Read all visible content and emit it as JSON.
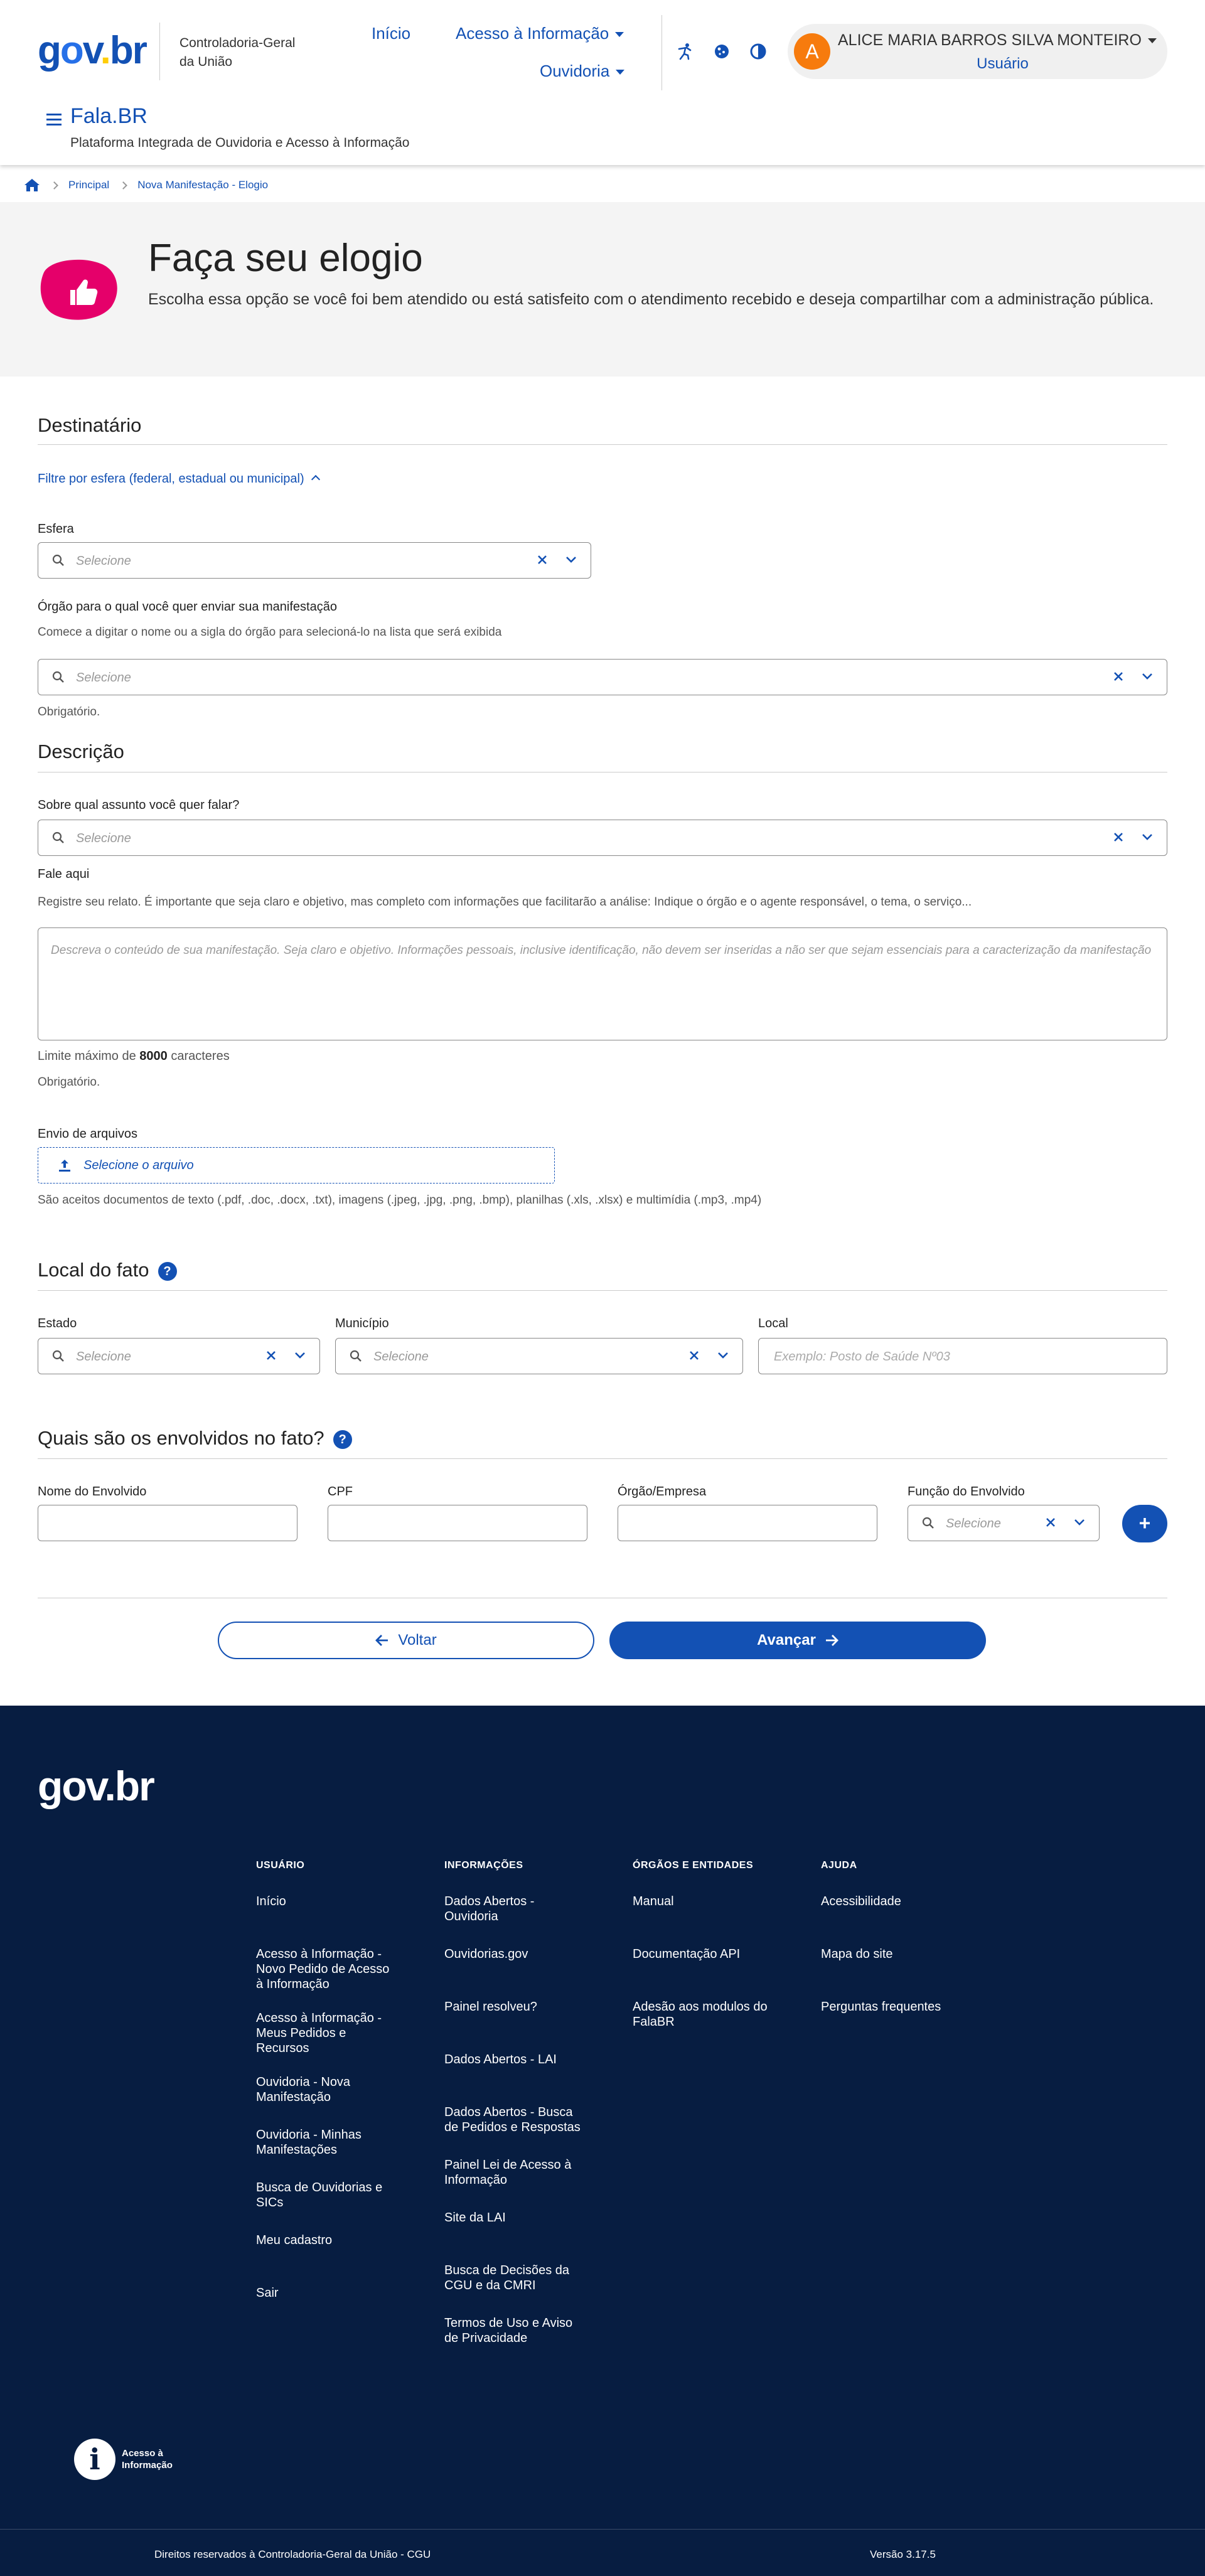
{
  "header": {
    "logo": {
      "g": "g",
      "o": "o",
      "v": "v",
      "dot": ".",
      "b": "b",
      "r": "r"
    },
    "org_line1": "Controladoria-Geral",
    "org_line2": "da União",
    "nav_inicio": "Início",
    "nav_acesso": "Acesso à Informação",
    "nav_ouvidoria": "Ouvidoria",
    "user_initial": "A",
    "user_name": "ALICE MARIA BARROS SILVA MONTEIRO",
    "user_role": "Usuário",
    "app_title": "Fala.BR",
    "app_subtitle": "Plataforma Integrada de Ouvidoria e Acesso à Informação"
  },
  "breadcrumb": {
    "item1": "Principal",
    "item2": "Nova Manifestação - Elogio"
  },
  "hero": {
    "title": "Faça seu elogio",
    "description": "Escolha essa opção se você foi bem atendido ou está satisfeito com o atendimento recebido e deseja compartilhar com a administração pública."
  },
  "destinatario": {
    "section_title": "Destinatário",
    "filter_link": "Filtre por esfera (federal, estadual ou municipal)",
    "esfera_label": "Esfera",
    "esfera_placeholder": "Selecione",
    "orgao_label": "Órgão para o qual você quer enviar sua manifestação",
    "orgao_hint": "Comece a digitar o nome ou a sigla do órgão para selecioná-lo na lista que será exibida",
    "orgao_placeholder": "Selecione",
    "required": "Obrigatório."
  },
  "descricao": {
    "section_title": "Descrição",
    "assunto_label": "Sobre qual assunto você quer falar?",
    "assunto_placeholder": "Selecione",
    "fale_label": "Fale aqui",
    "fale_hint": "Registre seu relato. É importante que seja claro e objetivo, mas completo com informações que facilitarão a análise: Indique o órgão e o agente responsável, o tema, o serviço...",
    "textarea_placeholder": "Descreva o conteúdo de sua manifestação. Seja claro e objetivo. Informações pessoais, inclusive identificação, não devem ser inseridas a não ser que sejam essenciais para a caracterização da manifestação",
    "limit_prefix": "Limite máximo de ",
    "limit_value": "8000",
    "limit_suffix": " caracteres",
    "required": "Obrigatório.",
    "upload_label": "Envio de arquivos",
    "upload_button": "Selecione o arquivo",
    "upload_hint": "São aceitos documentos de texto (.pdf, .doc, .docx, .txt), imagens (.jpeg, .jpg, .png, .bmp), planilhas (.xls, .xlsx) e multimídia (.mp3, .mp4)"
  },
  "local": {
    "section_title": "Local do fato",
    "help": "?",
    "estado_label": "Estado",
    "estado_placeholder": "Selecione",
    "municipio_label": "Município",
    "municipio_placeholder": "Selecione",
    "local_label": "Local",
    "local_placeholder": "Exemplo: Posto de Saúde Nº03"
  },
  "envolvidos": {
    "section_title": "Quais são os envolvidos no fato?",
    "help": "?",
    "nome_label": "Nome do Envolvido",
    "cpf_label": "CPF",
    "orgao_label": "Órgão/Empresa",
    "funcao_label": "Função do Envolvido",
    "funcao_placeholder": "Selecione",
    "add": "+"
  },
  "actions": {
    "back": "Voltar",
    "next": "Avançar"
  },
  "footer": {
    "logo": "gov.br",
    "columns": [
      {
        "heading": "USUÁRIO",
        "items": [
          "Início",
          "Acesso à Informação - Novo Pedido de Acesso à Informação",
          "Acesso à Informação - Meus Pedidos e Recursos",
          "Ouvidoria - Nova Manifestação",
          "Ouvidoria - Minhas Manifestações",
          "Busca de Ouvidorias e SICs",
          "Meu cadastro",
          "Sair"
        ]
      },
      {
        "heading": "INFORMAÇÕES",
        "items": [
          "Dados Abertos - Ouvidoria",
          "Ouvidorias.gov",
          "Painel resolveu?",
          "Dados Abertos - LAI",
          "Dados Abertos - Busca de Pedidos e Respostas",
          "Painel Lei de Acesso à Informação",
          "Site da LAI",
          "Busca de Decisões da CGU e da CMRI",
          "Termos de Uso e Aviso de Privacidade"
        ]
      },
      {
        "heading": "ÓRGÃOS E ENTIDADES",
        "items": [
          "Manual",
          "Documentação API",
          "Adesão aos modulos do FalaBR"
        ]
      },
      {
        "heading": "AJUDA",
        "items": [
          "Acessibilidade",
          "Mapa do site",
          "Perguntas frequentes"
        ]
      }
    ],
    "ai_logo_letter": "i",
    "ai_logo_line1": "Acesso à",
    "ai_logo_line2": "Informação",
    "copyright": "Direitos reservados à Controladoria-Geral da União - CGU",
    "version": "Versão 3.17.5"
  },
  "colors": {
    "primary": "#1351b4",
    "footer_bg": "#071d41",
    "accent_pink": "#e5006a",
    "avatar_orange": "#f77b0d"
  }
}
